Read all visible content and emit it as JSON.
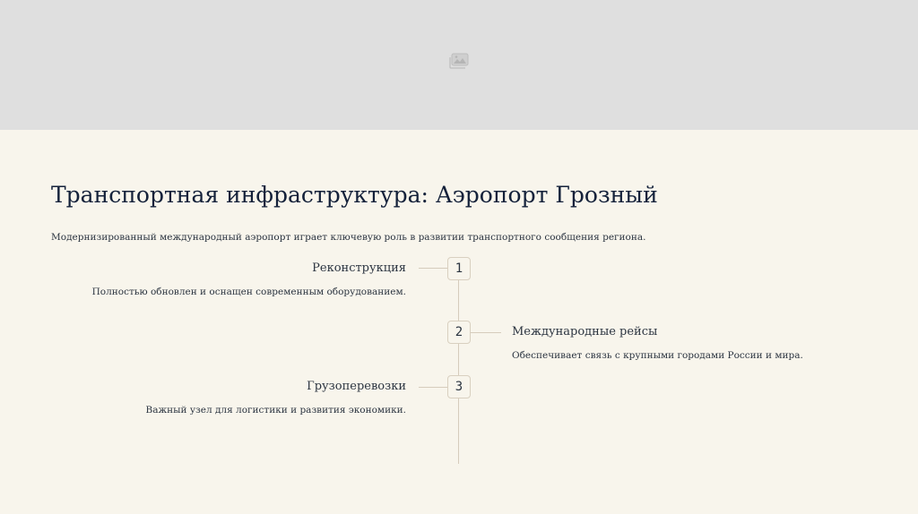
{
  "slide": {
    "hero_image_icon": "image-icon",
    "title": "Транспортная инфраструктура: Аэропорт Грозный",
    "subtitle": "Модернизированный международный аэропорт играет ключевую роль в развитии транспортного сообщения региона."
  },
  "timeline": {
    "steps": [
      {
        "number": "1",
        "heading": "Реконструкция",
        "description": "Полностью обновлен и оснащен современным оборудованием.",
        "side": "left"
      },
      {
        "number": "2",
        "heading": "Международные рейсы",
        "description": "Обеспечивает связь с крупными городами России и мира.",
        "side": "right"
      },
      {
        "number": "3",
        "heading": "Грузоперевозки",
        "description": "Важный узел для логистики и развития экономики.",
        "side": "left"
      }
    ]
  },
  "colors": {
    "background": "#f8f5ec",
    "hero_placeholder": "#dfdfdf",
    "title": "#14213a",
    "line": "#d6ccbc"
  }
}
